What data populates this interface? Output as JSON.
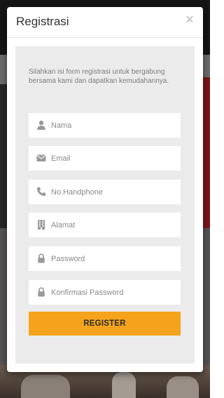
{
  "modal": {
    "title": "Registrasi",
    "close_label": "×",
    "intro": "Silahkan isi form registrasi untuk bergabung bersama kami dan dapatkan kemudahannya."
  },
  "fields": [
    {
      "name": "nama",
      "placeholder": "Nama",
      "icon": "user-icon"
    },
    {
      "name": "email",
      "placeholder": "Email",
      "icon": "envelope-icon"
    },
    {
      "name": "phone",
      "placeholder": "No.Handphone",
      "icon": "phone-icon"
    },
    {
      "name": "alamat",
      "placeholder": "Alamat",
      "icon": "building-icon"
    },
    {
      "name": "password",
      "placeholder": "Password",
      "icon": "lock-icon"
    },
    {
      "name": "confirm-password",
      "placeholder": "Konfirmasi Password",
      "icon": "lock-icon"
    }
  ],
  "register_button": {
    "label": "REGISTER",
    "color": "#f5a31c"
  },
  "colors": {
    "panel": "#ebebeb",
    "icon": "#9a9a9a",
    "overlay": "#4a4a4a"
  }
}
